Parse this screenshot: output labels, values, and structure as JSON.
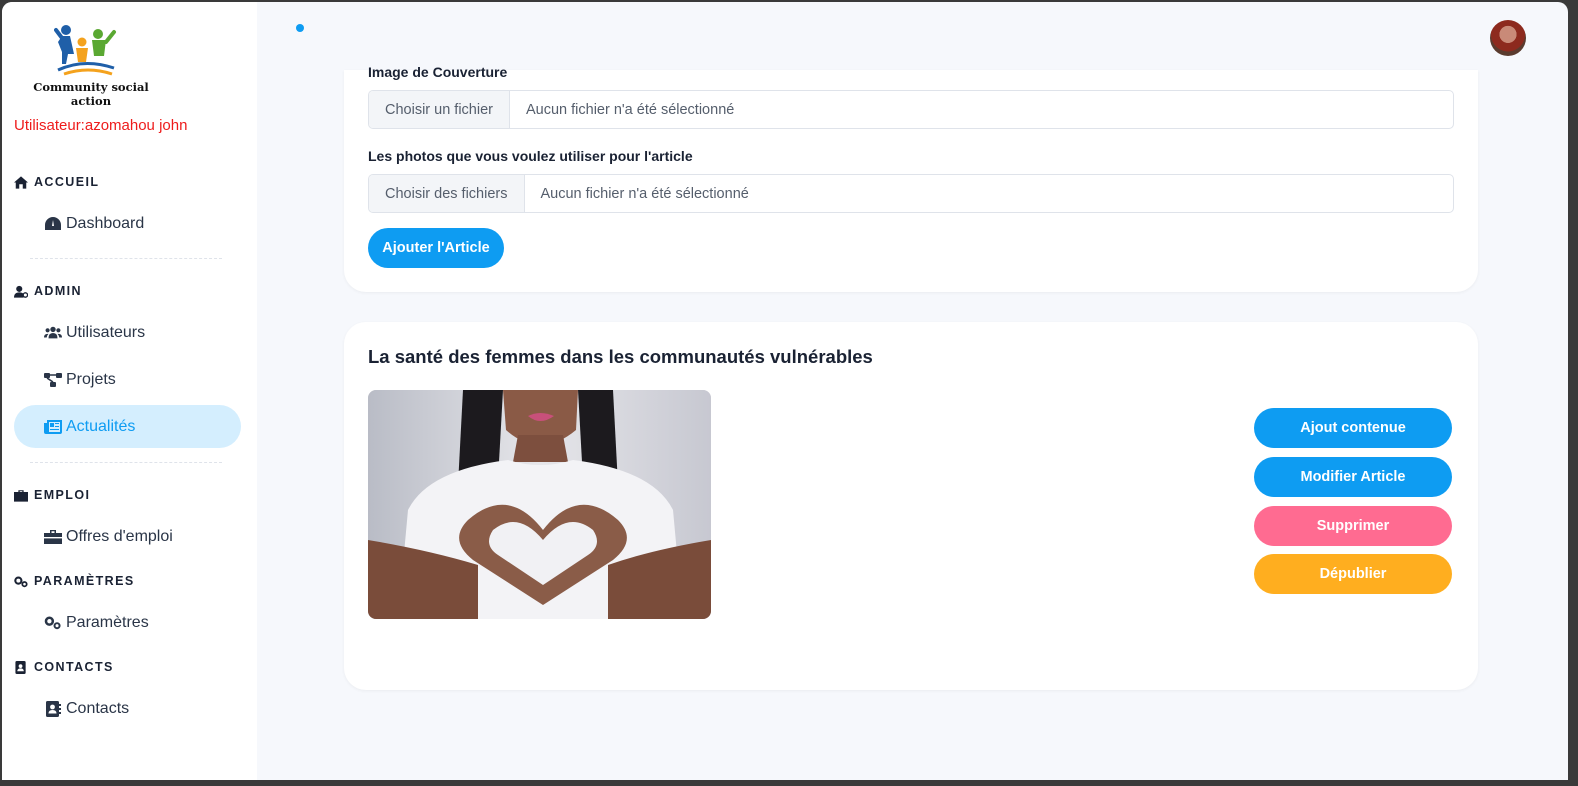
{
  "app": {
    "logo_text": "Community social action",
    "user_label": "Utilisateur:azomahou john"
  },
  "sidebar": {
    "sections": [
      {
        "title": "ACCUEIL",
        "icon": "home-icon",
        "items": [
          {
            "label": "Dashboard",
            "icon": "dashboard-icon"
          }
        ]
      },
      {
        "title": "ADMIN",
        "icon": "user-cog-icon",
        "items": [
          {
            "label": "Utilisateurs",
            "icon": "users-icon"
          },
          {
            "label": "Projets",
            "icon": "project-diagram-icon"
          },
          {
            "label": "Actualités",
            "icon": "newspaper-icon",
            "active": true
          }
        ]
      },
      {
        "title": "EMPLOI",
        "icon": "briefcase-icon",
        "items": [
          {
            "label": "Offres d'emploi",
            "icon": "briefcase-icon"
          }
        ]
      },
      {
        "title": "PARAMÈTRES",
        "icon": "cogs-icon",
        "items": [
          {
            "label": "Paramètres",
            "icon": "cogs-icon"
          }
        ]
      },
      {
        "title": "CONTACTS",
        "icon": "address-book-icon",
        "items": [
          {
            "label": "Contacts",
            "icon": "address-book-icon"
          }
        ]
      }
    ]
  },
  "form": {
    "cover_label": "Image de Couverture",
    "cover_button": "Choisir un fichier",
    "cover_status": "Aucun fichier n'a été sélectionné",
    "photos_label": "Les photos que vous voulez utiliser pour l'article",
    "photos_button": "Choisir des fichiers",
    "photos_status": "Aucun fichier n'a été sélectionné",
    "submit_label": "Ajouter l'Article"
  },
  "article": {
    "title": "La santé des femmes dans les communautés vulnérables",
    "image_icon": "heart-hands-photo",
    "actions": {
      "add_content": "Ajout contenue",
      "edit": "Modifier Article",
      "delete": "Supprimer",
      "unpublish": "Dépublier"
    }
  },
  "colors": {
    "primary": "#0e9cf2",
    "danger": "#ff6b91",
    "warning": "#ffae1f",
    "user_label": "#ee1c1c",
    "active_bg": "#d4eefe"
  }
}
